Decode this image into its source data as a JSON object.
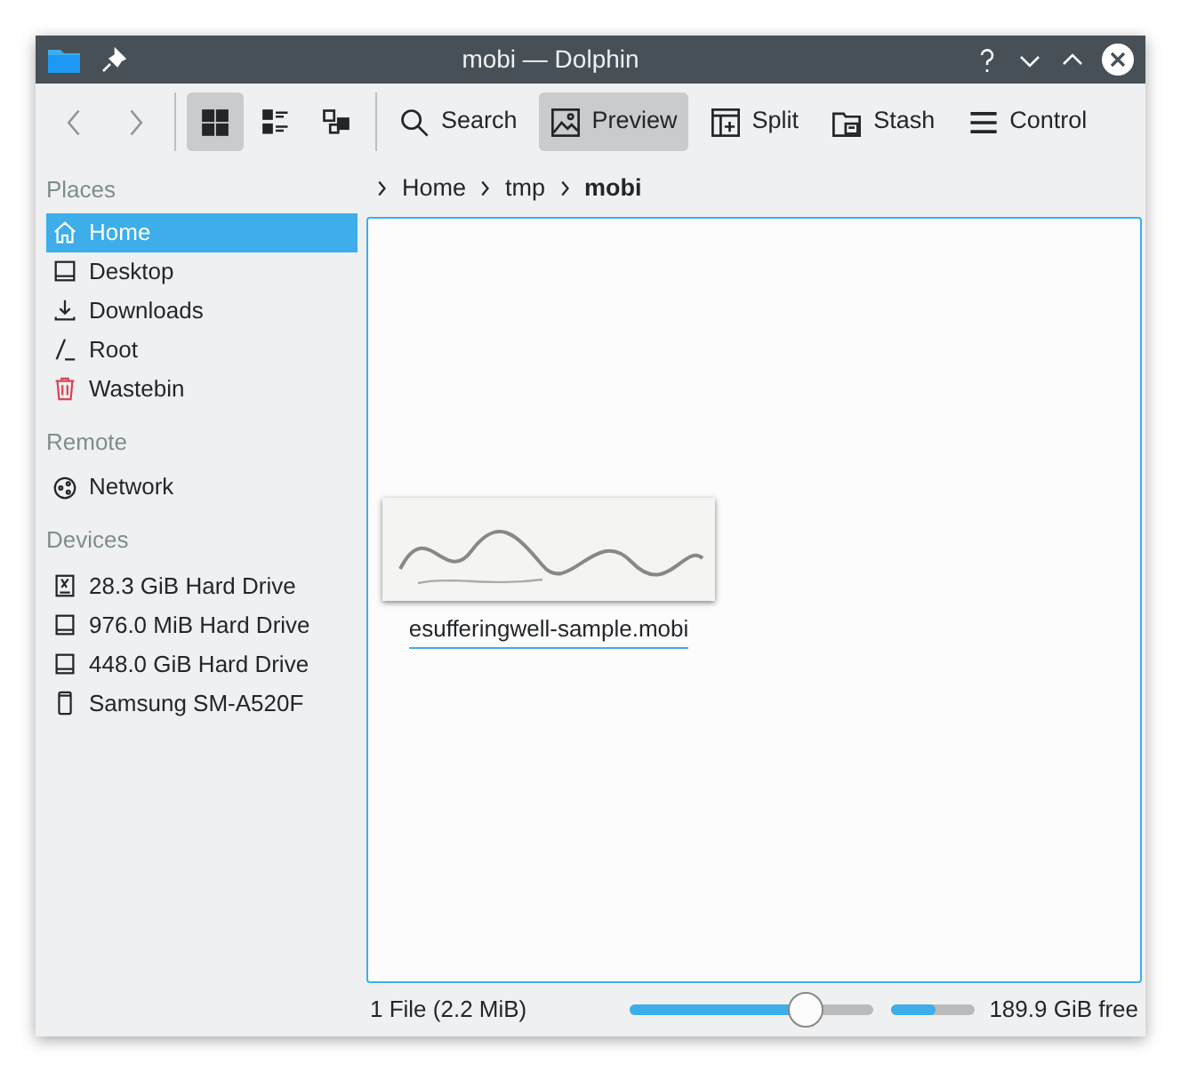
{
  "window": {
    "title": "mobi — Dolphin"
  },
  "toolbar": {
    "navigation": [
      {
        "kind": "back",
        "disabled": true
      },
      {
        "kind": "forward",
        "disabled": true
      }
    ],
    "view_modes": [
      {
        "kind": "icons",
        "selected": true
      },
      {
        "kind": "compact",
        "selected": false
      },
      {
        "kind": "details",
        "selected": false
      }
    ],
    "actions": [
      {
        "kind": "search",
        "label": "Search",
        "checked": false
      },
      {
        "kind": "preview",
        "label": "Preview",
        "checked": true
      },
      {
        "kind": "split",
        "label": "Split",
        "checked": false
      },
      {
        "kind": "stash",
        "label": "Stash",
        "checked": false
      },
      {
        "kind": "control",
        "label": "Control",
        "checked": false
      }
    ]
  },
  "sidebar": {
    "sections": [
      {
        "title": "Places",
        "items": [
          {
            "kind": "home",
            "label": "Home",
            "selected": true
          },
          {
            "kind": "desktop",
            "label": "Desktop",
            "selected": false
          },
          {
            "kind": "downloads",
            "label": "Downloads",
            "selected": false
          },
          {
            "kind": "root",
            "label": "Root",
            "selected": false
          },
          {
            "kind": "trash",
            "label": "Wastebin",
            "selected": false
          }
        ]
      },
      {
        "title": "Remote",
        "items": [
          {
            "kind": "network",
            "label": "Network",
            "selected": false
          }
        ]
      },
      {
        "title": "Devices",
        "items": [
          {
            "kind": "drive-alt",
            "label": "28.3 GiB Hard Drive",
            "selected": false
          },
          {
            "kind": "drive",
            "label": "976.0 MiB Hard Drive",
            "selected": false
          },
          {
            "kind": "drive",
            "label": "448.0 GiB Hard Drive",
            "selected": false
          },
          {
            "kind": "phone",
            "label": "Samsung SM-A520F",
            "selected": false
          }
        ]
      }
    ]
  },
  "breadcrumb": [
    {
      "label": "Home",
      "current": false
    },
    {
      "label": "tmp",
      "current": false
    },
    {
      "label": "mobi",
      "current": true
    }
  ],
  "files": [
    {
      "kind": "picture",
      "name": "esufferingwell-sample.mobi",
      "focused": true
    }
  ],
  "status_bar": {
    "summary": "1 File (2.2 MiB)",
    "zoom": {
      "level": 0.72
    },
    "disk": {
      "level": 0.54
    },
    "free": "189.9 GiB free"
  }
}
